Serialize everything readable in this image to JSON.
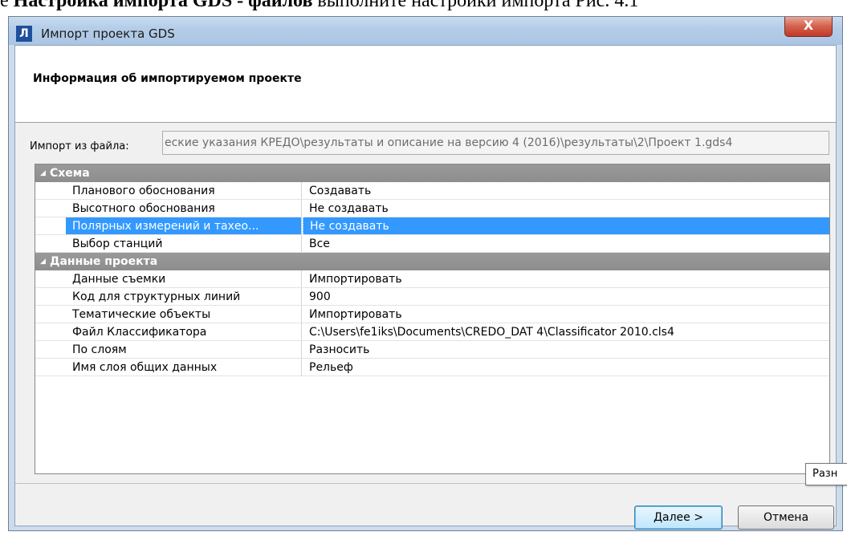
{
  "document": {
    "prefix": "е ",
    "bold_text": "Настройка импорта GDS - файлов",
    "suffix": " выполните настройки импорта Рис. 4.1"
  },
  "window": {
    "app_icon": "Л",
    "title": "Импорт проекта GDS",
    "close_label": "X"
  },
  "header": {
    "title": "Информация об импортируемом проекте"
  },
  "import_from": {
    "label": "Импорт из файла:",
    "value": "еские указания КРЕДО\\результаты и описание на версию 4 (2016)\\результаты\\2\\Проект 1.gds4"
  },
  "groups": [
    {
      "title": "Схема",
      "rows": [
        {
          "name": "Планового обоснования",
          "value": "Создавать"
        },
        {
          "name": "Высотного обоснования",
          "value": "Не создавать"
        },
        {
          "name": "Полярных измерений и тахео...",
          "value": "Не создавать"
        },
        {
          "name": "Выбор станций",
          "value": "Все"
        }
      ]
    },
    {
      "title": "Данные проекта",
      "rows": [
        {
          "name": "Данные съемки",
          "value": "Импортировать"
        },
        {
          "name": "Код для структурных линий",
          "value": "900"
        },
        {
          "name": "Тематические объекты",
          "value": "Импортировать"
        },
        {
          "name": "Файл Классификатора",
          "value": "C:\\Users\\fe1iks\\Documents\\CREDO_DAT 4\\Classificator 2010.cls4"
        },
        {
          "name": "По слоям",
          "value": "Разносить"
        },
        {
          "name": "Имя слоя общих данных",
          "value": "Рельеф"
        }
      ]
    }
  ],
  "selected_row": "Полярных измерений и тахео...",
  "buttons": {
    "next": "Далее >",
    "cancel": "Отмена"
  },
  "tooltip": "Разн",
  "colors": {
    "selection": "#3399ff",
    "group_header": "#8d8d8d"
  }
}
